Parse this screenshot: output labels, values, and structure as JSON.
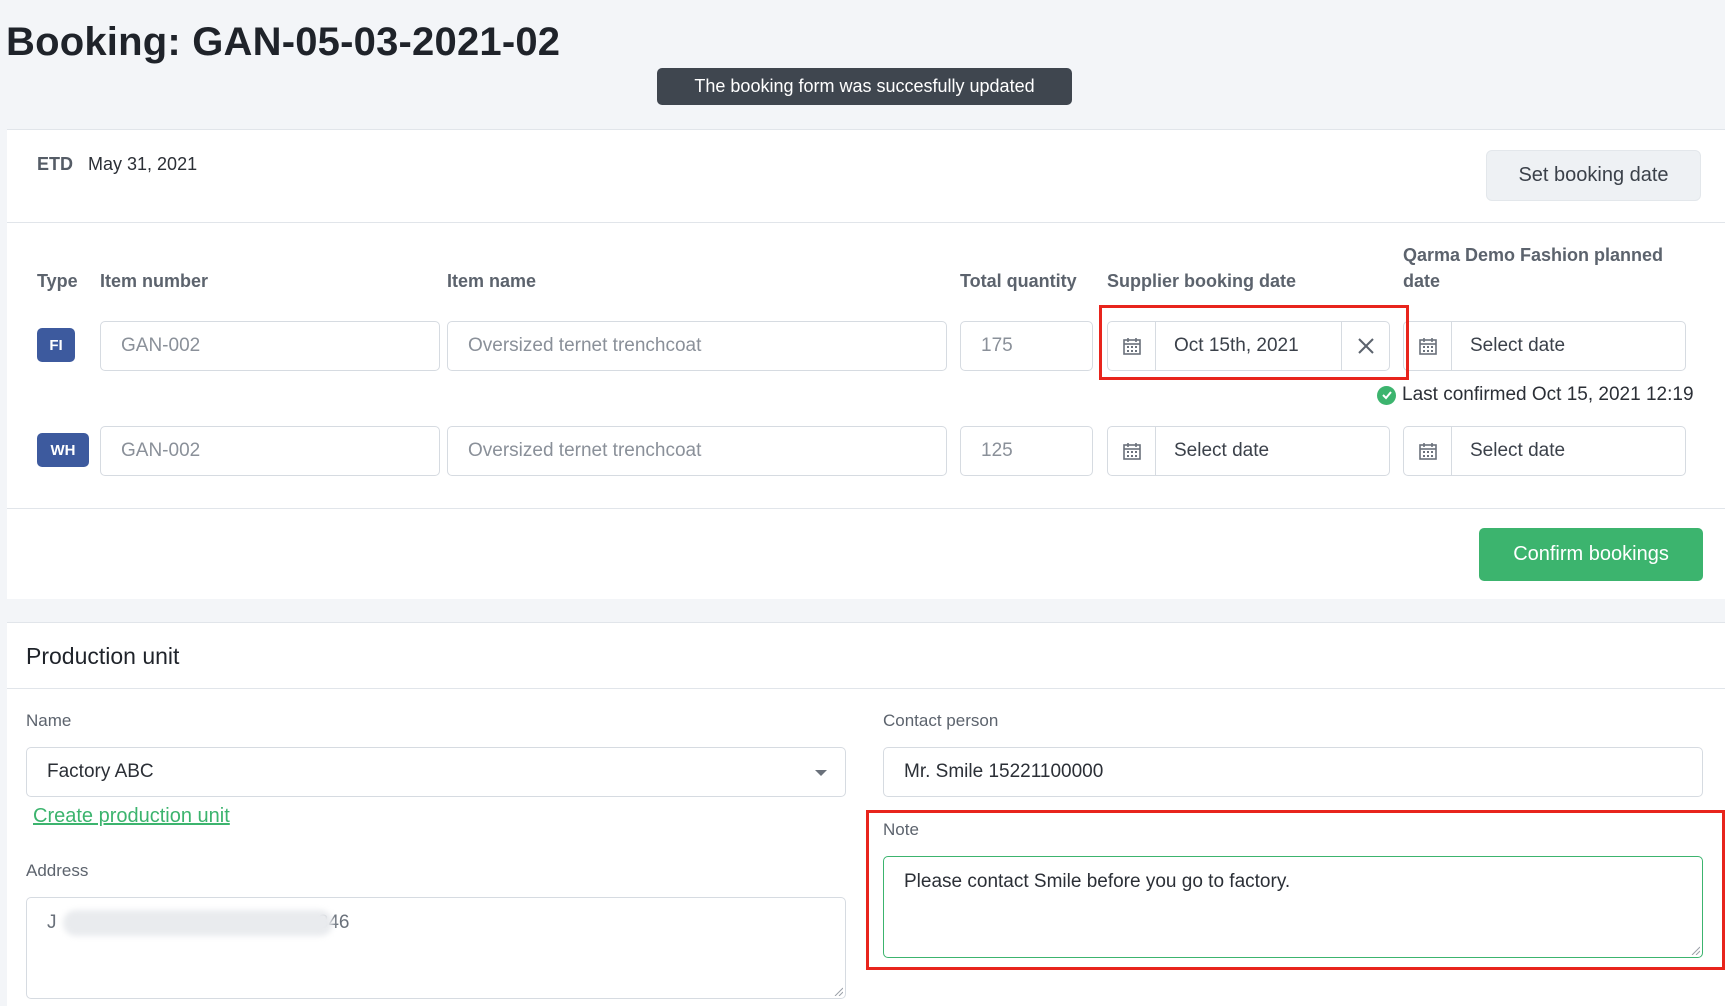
{
  "page": {
    "title": "Booking: GAN-05-03-2021-02",
    "toast": "The booking form was succesfully updated"
  },
  "summary": {
    "etd_label": "ETD",
    "etd_value": "May 31, 2021",
    "set_booking_date_label": "Set booking date"
  },
  "table": {
    "headers": {
      "type": "Type",
      "item_number": "Item number",
      "item_name": "Item name",
      "total_quantity": "Total quantity",
      "supplier_booking_date": "Supplier booking date",
      "planned_date": "Qarma Demo Fashion planned date"
    },
    "rows": [
      {
        "type": "FI",
        "item_number": "GAN-002",
        "item_name": "Oversized ternet trenchcoat",
        "quantity": "175",
        "supplier_date": "Oct 15th, 2021",
        "planned_date": "Select date",
        "confirmation": "Last confirmed Oct 15, 2021 12:19"
      },
      {
        "type": "WH",
        "item_number": "GAN-002",
        "item_name": "Oversized ternet trenchcoat",
        "quantity": "125",
        "supplier_date": "Select date",
        "planned_date": "Select date"
      }
    ],
    "confirm_button": "Confirm bookings"
  },
  "production_unit": {
    "section_title": "Production unit",
    "name_label": "Name",
    "name_value": "Factory ABC",
    "create_link": "Create production unit",
    "address_label": "Address",
    "address_value_visible_start": "J",
    "address_value_visible_end": "846",
    "contact_label": "Contact person",
    "contact_value": "Mr. Smile 15221100000",
    "note_label": "Note",
    "note_value": "Please contact Smile before you go to factory."
  },
  "colors": {
    "accent_green": "#3cb46e",
    "badge_blue": "#3d5a9e",
    "highlight_red": "#e8241c",
    "toast_bg": "#3f464f"
  },
  "icons": [
    "calendar-icon",
    "close-icon",
    "check-circle-icon",
    "chevron-down-icon",
    "resize-grip-icon"
  ]
}
